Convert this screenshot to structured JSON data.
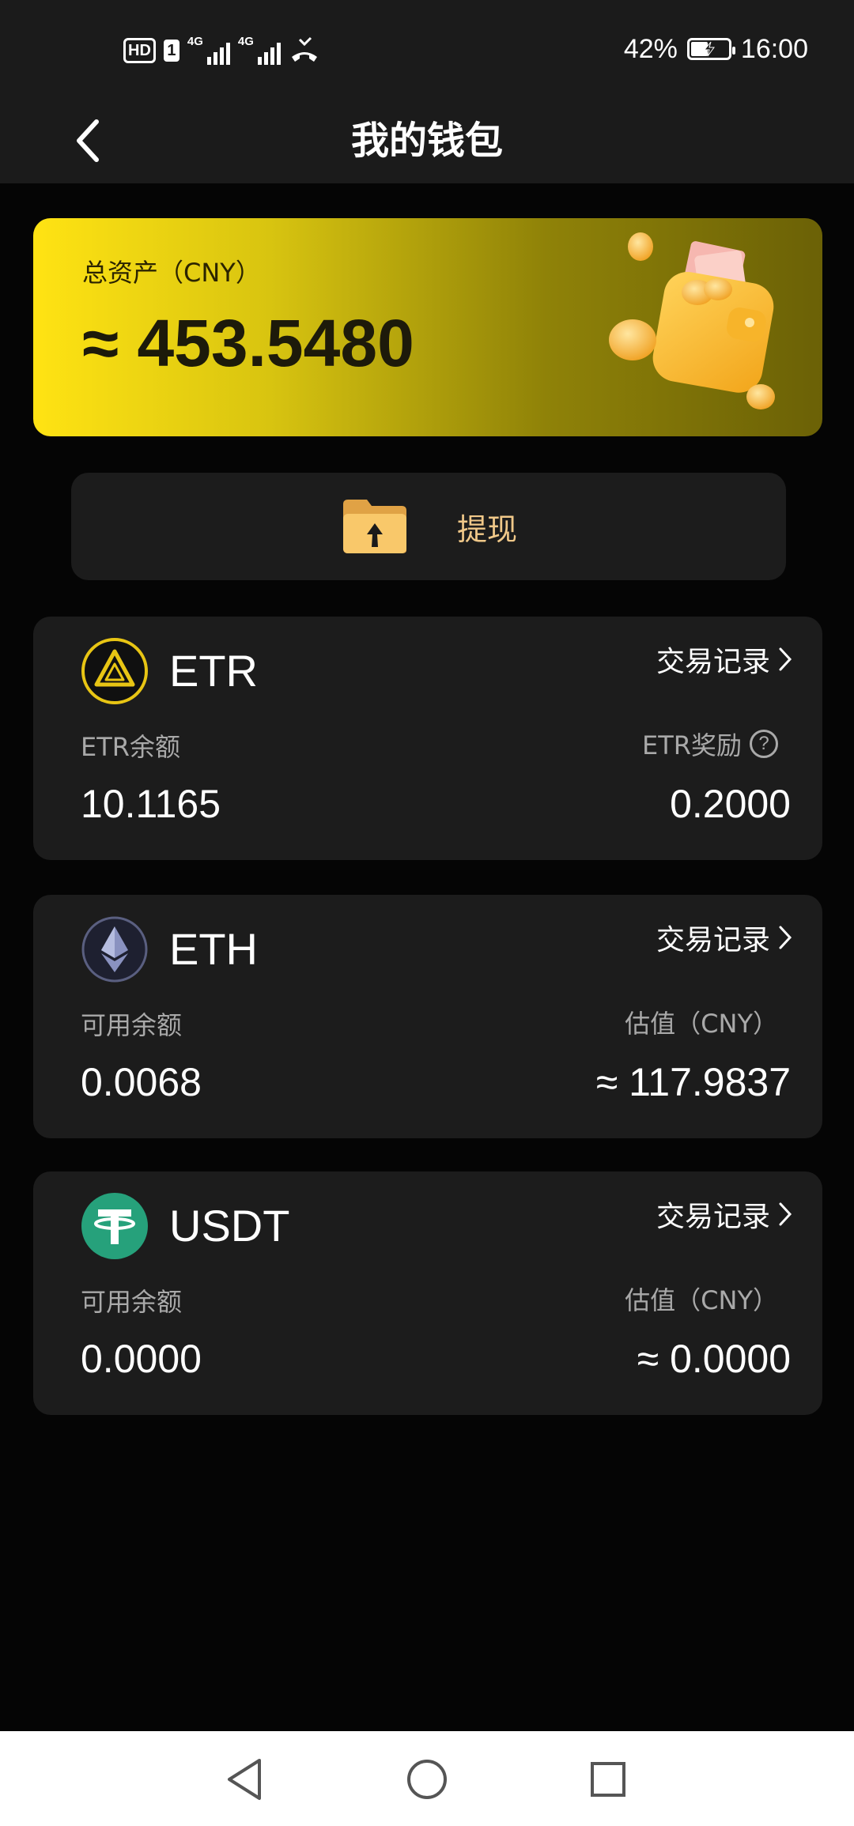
{
  "status_bar": {
    "hd": "HD",
    "sim": "1",
    "net1": "4G",
    "net2": "4G",
    "battery_pct": "42%",
    "time": "16:00"
  },
  "header": {
    "title": "我的钱包",
    "back_icon": "chevron-left-icon"
  },
  "asset": {
    "label": "总资产（CNY）",
    "value": "≈ 453.5480"
  },
  "withdraw": {
    "label": "提现",
    "icon": "folder-upload-icon"
  },
  "coins": [
    {
      "name": "ETR",
      "tx_label": "交易记录",
      "left_label": "ETR余额",
      "left_value": "10.1165",
      "right_label": "ETR奖励",
      "right_value": "0.2000",
      "help_glyph": "?"
    },
    {
      "name": "ETH",
      "tx_label": "交易记录",
      "left_label": "可用余额",
      "left_value": "0.0068",
      "right_label": "估值（CNY）",
      "right_value": "≈ 117.9837"
    },
    {
      "name": "USDT",
      "tx_label": "交易记录",
      "left_label": "可用余额",
      "left_value": "0.0000",
      "right_label": "估值（CNY）",
      "right_value": "≈ 0.0000"
    }
  ],
  "colors": {
    "accent_gold": "#f0c889",
    "card_bg": "#1c1c1c",
    "page_bg": "#050505",
    "etr_ring": "#e8c514",
    "usdt_green": "#26a17b",
    "eth_bg": "#2b2d3e"
  }
}
